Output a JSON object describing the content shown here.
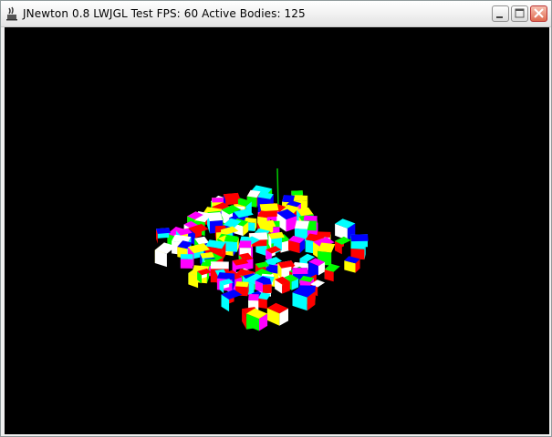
{
  "window": {
    "title": "JNewton 0.8 LWJGL Test FPS: 60 Active Bodies: 125",
    "icons": {
      "app": "java-app-icon",
      "minimize": "minimize-icon",
      "maximize": "maximize-icon",
      "close": "close-icon"
    }
  },
  "scene": {
    "background": "#000000",
    "palette": [
      "#ff0000",
      "#00ff00",
      "#0000ff",
      "#ffff00",
      "#ff00ff",
      "#00ffff",
      "#ffffff"
    ],
    "description_shape": "pile-of-colored-cubes"
  }
}
